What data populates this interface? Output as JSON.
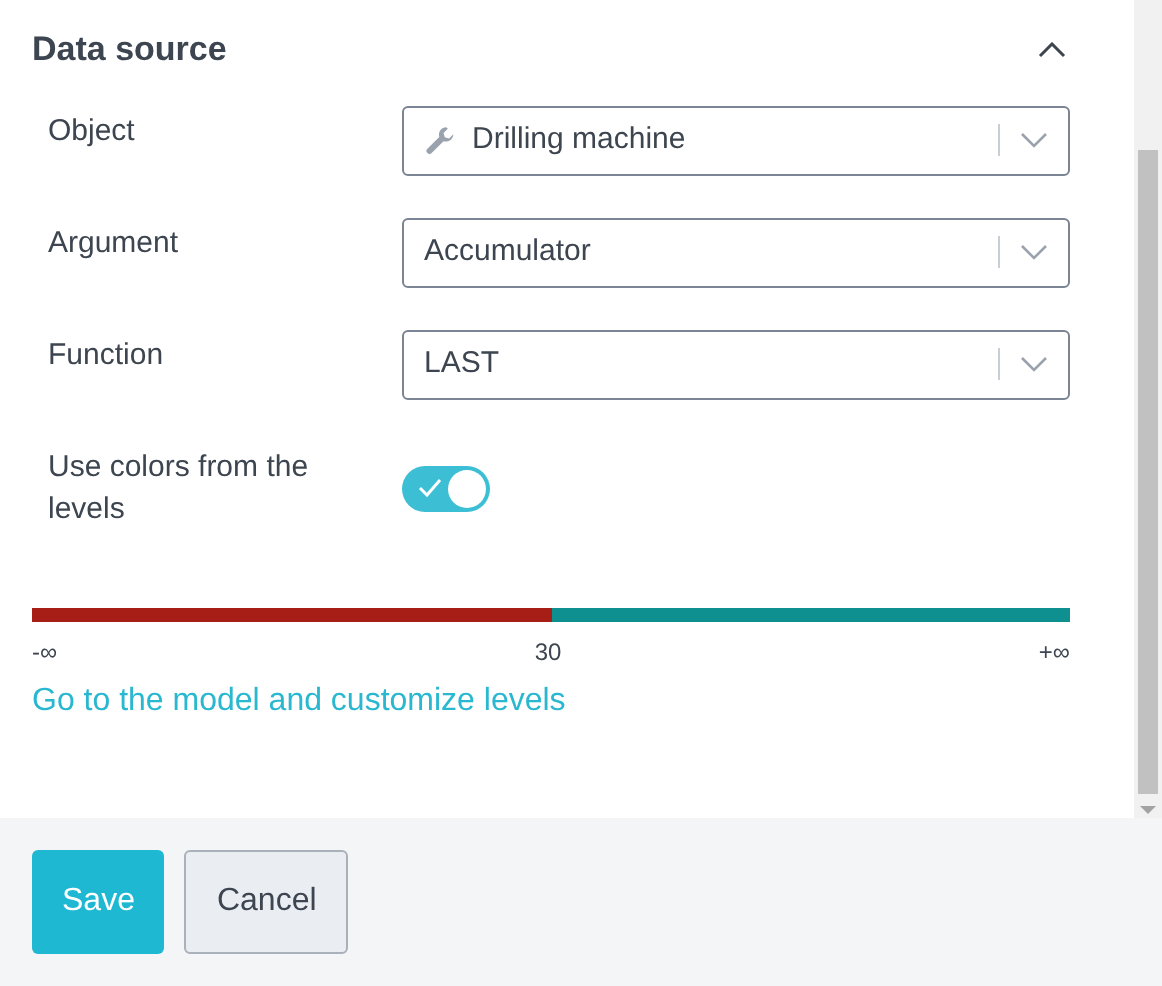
{
  "section": {
    "title": "Data source",
    "expanded": true
  },
  "fields": [
    {
      "kind": "object-select",
      "label": "Object",
      "value": "Drilling machine"
    },
    {
      "kind": "select",
      "label": "Argument",
      "value": "Accumulator"
    },
    {
      "kind": "select",
      "label": "Function",
      "value": "LAST"
    },
    {
      "kind": "toggle",
      "label": "Use colors from the levels",
      "on": true
    }
  ],
  "levels": {
    "segments": [
      {
        "color": "#a61e16"
      },
      {
        "color": "#0e9090"
      }
    ],
    "labels": [
      "-∞",
      "30",
      "+∞"
    ]
  },
  "link": "Go to the model and customize levels",
  "buttons": [
    {
      "label": "Save",
      "kind": "primary"
    },
    {
      "label": "Cancel",
      "kind": "secondary"
    }
  ]
}
